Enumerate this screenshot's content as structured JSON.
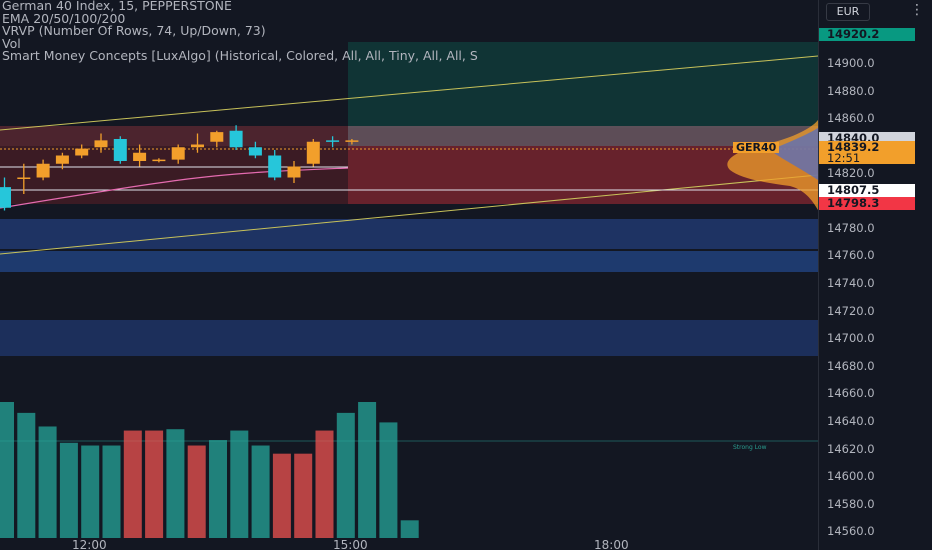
{
  "legend": {
    "title": "German 40 Index, 15, PEPPERSTONE",
    "ema": "EMA 20/50/100/200",
    "vrvp": "VRVP (Number Of Rows, 74, Up/Down, 73)",
    "vol": "Vol",
    "smc": "Smart Money Concepts [LuxAlgo] (Historical, Colored, All, All, Tiny, All, All, S"
  },
  "toolbar": {
    "currency": "EUR",
    "menu_icon": "more-vertical-icon"
  },
  "price_axis": {
    "ticks": [
      "14900.0",
      "14880.0",
      "14860.0",
      "14820.0",
      "14780.0",
      "14760.0",
      "14740.0",
      "14720.0",
      "14700.0",
      "14680.0",
      "14660.0",
      "14640.0",
      "14620.0",
      "14600.0",
      "14580.0",
      "14560.0"
    ],
    "labels": {
      "top_green": "14920.2",
      "highlight": "14840.0",
      "current": "14839.2",
      "countdown": "12:51",
      "white": "14807.5",
      "red": "14798.3"
    }
  },
  "symbol_label": "GER40",
  "strong_low": "Strong Low",
  "time_axis": [
    "12:00",
    "15:00",
    "18:00"
  ],
  "chart_data": {
    "type": "candlestick",
    "candles": [
      {
        "o": 14805,
        "h": 14812,
        "l": 14788,
        "c": 14790
      },
      {
        "o": 14812,
        "h": 14822,
        "l": 14800,
        "c": 14812
      },
      {
        "o": 14812,
        "h": 14825,
        "l": 14810,
        "c": 14822
      },
      {
        "o": 14822,
        "h": 14830,
        "l": 14818,
        "c": 14828
      },
      {
        "o": 14828,
        "h": 14836,
        "l": 14826,
        "c": 14833
      },
      {
        "o": 14834,
        "h": 14844,
        "l": 14830,
        "c": 14839
      },
      {
        "o": 14840,
        "h": 14842,
        "l": 14822,
        "c": 14824
      },
      {
        "o": 14824,
        "h": 14836,
        "l": 14820,
        "c": 14830
      },
      {
        "o": 14824,
        "h": 14826,
        "l": 14823,
        "c": 14825
      },
      {
        "o": 14825,
        "h": 14836,
        "l": 14822,
        "c": 14834
      },
      {
        "o": 14834,
        "h": 14844,
        "l": 14830,
        "c": 14836
      },
      {
        "o": 14838,
        "h": 14846,
        "l": 14834,
        "c": 14845
      },
      {
        "o": 14846,
        "h": 14850,
        "l": 14832,
        "c": 14834
      },
      {
        "o": 14834,
        "h": 14838,
        "l": 14826,
        "c": 14828
      },
      {
        "o": 14828,
        "h": 14832,
        "l": 14810,
        "c": 14812
      },
      {
        "o": 14812,
        "h": 14824,
        "l": 14808,
        "c": 14820
      },
      {
        "o": 14822,
        "h": 14840,
        "l": 14820,
        "c": 14838
      },
      {
        "o": 14839,
        "h": 14842,
        "l": 14834,
        "c": 14838
      },
      {
        "o": 14838,
        "h": 14840,
        "l": 14836,
        "c": 14839
      }
    ],
    "volume": [
      {
        "v": 100,
        "d": "up"
      },
      {
        "v": 92,
        "d": "up"
      },
      {
        "v": 82,
        "d": "up"
      },
      {
        "v": 70,
        "d": "up"
      },
      {
        "v": 68,
        "d": "up"
      },
      {
        "v": 68,
        "d": "up"
      },
      {
        "v": 79,
        "d": "down"
      },
      {
        "v": 79,
        "d": "down"
      },
      {
        "v": 80,
        "d": "up"
      },
      {
        "v": 68,
        "d": "down"
      },
      {
        "v": 72,
        "d": "up"
      },
      {
        "v": 79,
        "d": "up"
      },
      {
        "v": 68,
        "d": "up"
      },
      {
        "v": 62,
        "d": "down"
      },
      {
        "v": 62,
        "d": "down"
      },
      {
        "v": 79,
        "d": "down"
      },
      {
        "v": 92,
        "d": "up"
      },
      {
        "v": 100,
        "d": "up"
      },
      {
        "v": 85,
        "d": "up"
      },
      {
        "v": 13,
        "d": "up"
      }
    ],
    "colors": {
      "up_candle": "#f29f2b",
      "down_candle": "#26c6da",
      "vol_up": "#26a69a",
      "vol_down": "#ef5350",
      "background": "#131722"
    }
  }
}
